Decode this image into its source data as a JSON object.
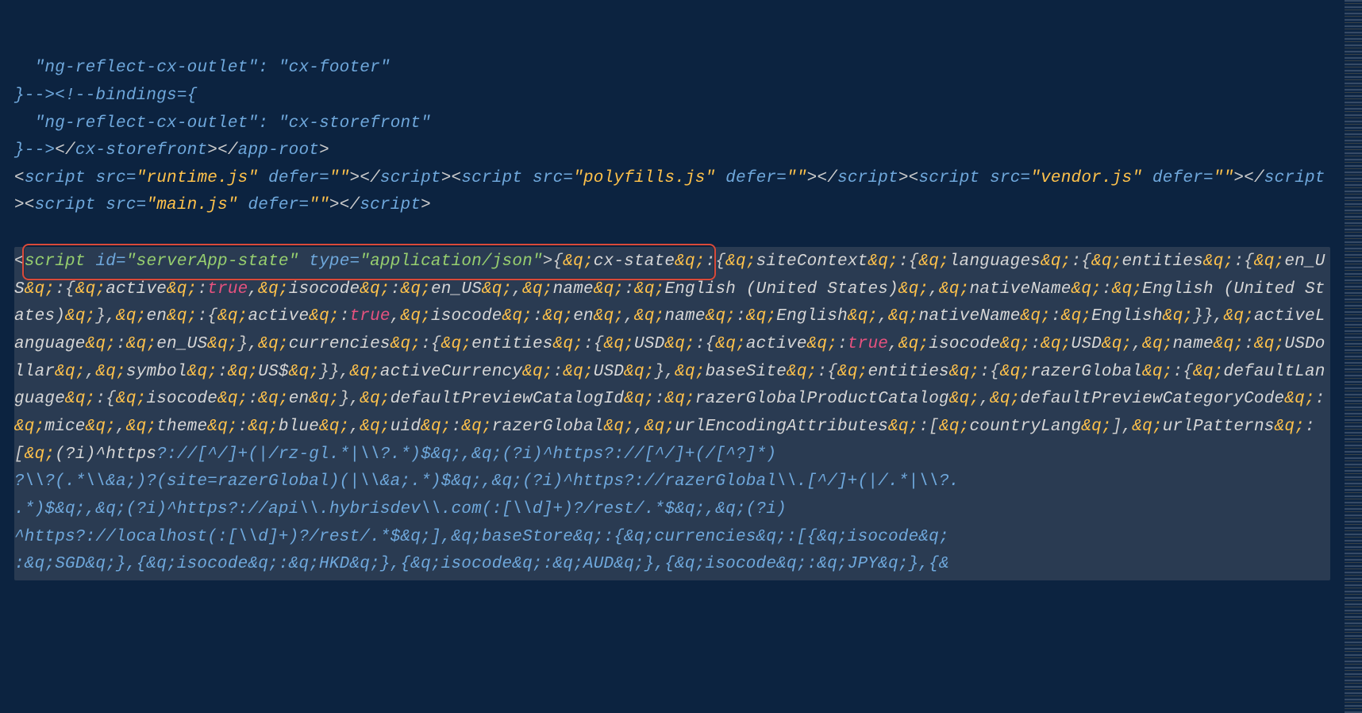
{
  "block1": {
    "comment1": {
      "attr": "\"ng-reflect-cx-outlet\"",
      "value": "\"cx-footer\""
    },
    "bindings_open": "}--><​!--bindings={",
    "comment2": {
      "attr": "\"ng-reflect-cx-outlet\"",
      "value": "\"cx-storefront\""
    },
    "close_line": "}--></cx-storefront></app-root>",
    "scripts": {
      "runtime": "\"runtime.js\"",
      "polyfills": "\"polyfills.js\"",
      "vendor": "\"vendor.js\"",
      "main": "\"main.js\"",
      "defer": "\"\""
    }
  },
  "highlight": {
    "script_open": "<script",
    "id_attr": "id=",
    "id_value": "\"serverApp-state\"",
    "type_attr": "type=",
    "type_value": "\"application/json\"",
    "close": ">"
  },
  "json_body": {
    "q": "&q;",
    "cx_state": "cx-state",
    "siteContext": "siteContext",
    "languages": "languages",
    "entities": "entities",
    "en_US": "en_US",
    "active": "active",
    "true": "true",
    "isocode": "isocode",
    "name": "name",
    "english_us": "English (United States)",
    "nativeName": "nativeName",
    "en": "en",
    "English": "English",
    "activeLanguage": "activeLanguage",
    "currencies": "currencies",
    "USD": "USD",
    "USDollar": "USDollar",
    "symbol": "symbol",
    "USsym": "US$",
    "activeCurrency": "activeCurrency",
    "baseSite": "baseSite",
    "razerGlobal": "razerGlobal",
    "defaultLanguage": "defaultLanguage",
    "defaultPreviewCatalogId": "defaultPreviewCatalogId",
    "razerGlobalProductCatalog": "razerGlobalProductCatalog",
    "defaultPreviewCategoryCode": "defaultPreviewCategoryCode",
    "mice": "mice",
    "theme": "theme",
    "blue": "blue",
    "uid": "uid",
    "urlEncodingAttributes": "urlEncodingAttributes",
    "countryLang": "countryLang",
    "urlPatterns": "urlPatterns",
    "regex_prefix": "(?i)^https",
    "regex_body1": "?://[^/]+(|/rz-gl.*|\\\\?.*)$&q;,&q;(?i)^https?://[^/]+(/[^?]*)",
    "regex_body2": "?\\\\?(.*\\\\&a;)?(site=razerGlobal)(|\\\\&a;.*)$&q;,&q;(?i)^https?://razerGlobal\\\\.[^/]+(|/.*|\\\\?.",
    "regex_body3": ".*)$&q;,&q;(?i)^https?://api\\\\.hybrisdev\\\\.com(:[\\\\d]+)?/rest/.*$&q;,&q;(?i)",
    "regex_body4": "^https?://localhost(:[\\\\d]+)?/rest/.*$&q;],&q;baseStore&q;:{&q;currencies&q;:[{&q;isocode&q;",
    "regex_body5": ":&q;SGD&q;},{&q;isocode&q;:&q;HKD&q;},{&q;isocode&q;:&q;AUD&q;},{&q;isocode&q;:&q;JPY&q;},{&"
  }
}
